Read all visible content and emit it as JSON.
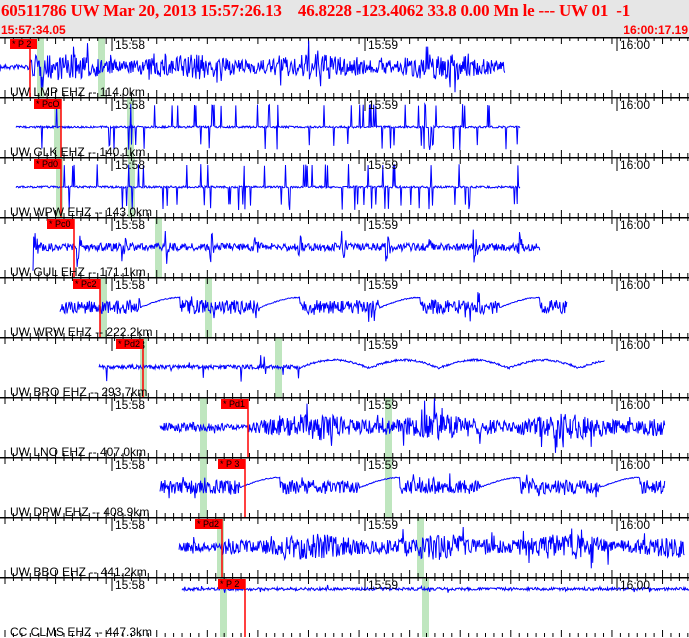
{
  "header": {
    "title": "60511786 UW Mar 20, 2013 15:57:26.13    46.8228 -123.4062 33.8 0.00 Mn le --- UW 01  -1",
    "start_time": "15:57:34.05",
    "end_time": "16:00:17.19"
  },
  "colors": {
    "trace": "#0000ff",
    "pick": "#ff0000",
    "window": "#bfe6bf",
    "header_text": "#ff0000",
    "header_bg": "#e6e6e6"
  },
  "time_marks": [
    "15:58",
    "15:59",
    "16:00"
  ],
  "channels": [
    {
      "label": "UW LMP EHZ -- 114.0km",
      "pick": "* P 2",
      "style": "noise"
    },
    {
      "label": "UW GLK EHZ -- 140.1km",
      "pick": "* PcO",
      "style": "spiky"
    },
    {
      "label": "UW WPW EHZ -- 143.0km",
      "pick": "* Pd0",
      "style": "spiky"
    },
    {
      "label": "UW GUL EHZ -- 171.1km",
      "pick": "* Pc0",
      "style": "bursts"
    },
    {
      "label": "UW WRW EHZ -- 222.2km",
      "pick": "* Pc2",
      "style": "drift"
    },
    {
      "label": "UW BRO EHZ -- 293.7km",
      "pick": "* Pd2",
      "style": "quiet"
    },
    {
      "label": "UW LNO EHZ -- 407.0km",
      "pick": "* Pd1",
      "style": "noise"
    },
    {
      "label": "UW DPW EHZ -- 408.9km",
      "pick": "* P 3",
      "style": "drift"
    },
    {
      "label": "UW BBO EHZ -- 441.2km",
      "pick": "* Pd2",
      "style": "noise"
    },
    {
      "label": "CC CLMS EHZ -- 447.3km",
      "pick": "* P 2",
      "style": "flat"
    }
  ]
}
